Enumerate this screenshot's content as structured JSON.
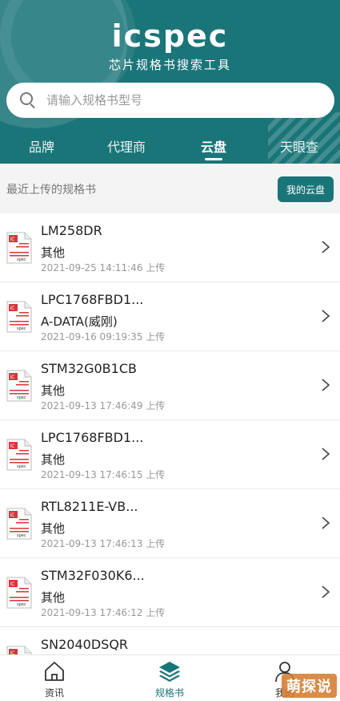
{
  "header": {
    "logo": "icspec",
    "subtitle": "芯片规格书搜索工具",
    "bg_color": "#1a7578"
  },
  "search": {
    "placeholder": "请输入规格书型号",
    "value": "",
    "icon": "search-icon"
  },
  "tabs": [
    {
      "label": "品牌",
      "active": false
    },
    {
      "label": "代理商",
      "active": false
    },
    {
      "label": "云盘",
      "active": true
    },
    {
      "label": "天眼查",
      "active": false
    }
  ],
  "section": {
    "title": "最近上传的规格书",
    "button_label": "我的云盘"
  },
  "file_icon_text": {
    "top": "iC",
    "bottom": "spec"
  },
  "items": [
    {
      "name": "LM258DR",
      "category": "其他",
      "time": "2021-09-25 14:11:46 上传"
    },
    {
      "name": "LPC1768FBD1...",
      "category": "A-DATA(威刚)",
      "time": "2021-09-16 09:19:35 上传"
    },
    {
      "name": "STM32G0B1CB",
      "category": "其他",
      "time": "2021-09-13 17:46:49 上传"
    },
    {
      "name": "LPC1768FBD1...",
      "category": "其他",
      "time": "2021-09-13 17:46:15 上传"
    },
    {
      "name": "RTL8211E-VB...",
      "category": "其他",
      "time": "2021-09-13 17:46:13 上传"
    },
    {
      "name": "STM32F030K6...",
      "category": "其他",
      "time": "2021-09-13 17:46:12 上传"
    },
    {
      "name": "SN2040DSQR",
      "category": "",
      "time": ""
    }
  ],
  "bottom_nav": [
    {
      "label": "资讯",
      "icon": "home-icon",
      "active": false
    },
    {
      "label": "规格书",
      "icon": "layers-icon",
      "active": true
    },
    {
      "label": "我的",
      "icon": "user-icon",
      "active": false
    }
  ],
  "watermark": "萌探说",
  "colors": {
    "accent": "#1a7578",
    "file_red": "#d8353a"
  }
}
